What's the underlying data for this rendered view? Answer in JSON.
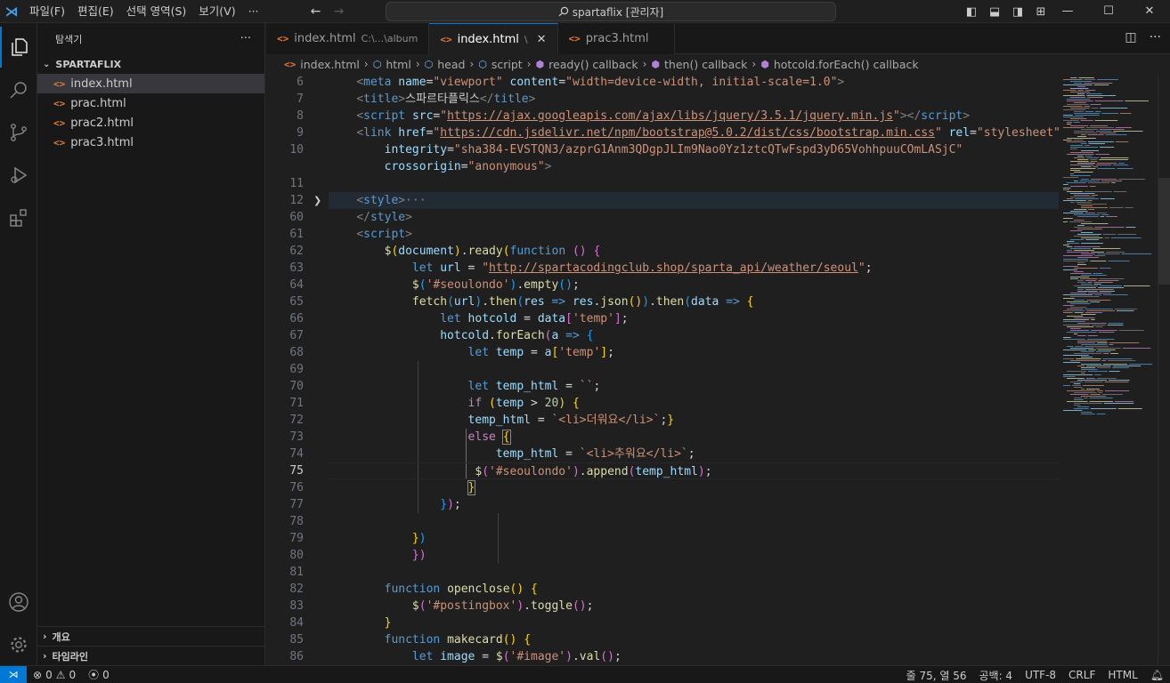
{
  "titlebar": {
    "menu": [
      "파일(F)",
      "편집(E)",
      "선택 영역(S)",
      "보기(V)",
      "···"
    ],
    "search_text": "spartaflix [관리자]",
    "minimize": "—",
    "maximize": "☐",
    "close": "✕"
  },
  "sidebar": {
    "title": "탐색기",
    "more": "···",
    "folder": "SPARTAFLIX",
    "files": [
      "index.html",
      "prac.html",
      "prac2.html",
      "prac3.html"
    ],
    "selected_file": "index.html",
    "outline_label": "개요",
    "timeline_label": "타임라인"
  },
  "tabs": [
    {
      "label": "index.html",
      "desc": "C:\\...\\album",
      "active": false
    },
    {
      "label": "index.html",
      "desc": "\\",
      "active": true
    },
    {
      "label": "prac3.html",
      "desc": "",
      "active": false
    }
  ],
  "breadcrumbs": [
    "index.html",
    "html",
    "head",
    "script",
    "ready() callback",
    "then() callback",
    "hotcold.forEach() callback"
  ],
  "editor": {
    "line_numbers": [
      "6",
      "7",
      "8",
      "9",
      "10",
      "",
      "11",
      "12",
      "60",
      "61",
      "62",
      "63",
      "64",
      "65",
      "66",
      "67",
      "68",
      "69",
      "70",
      "71",
      "72",
      "73",
      "74",
      "75",
      "76",
      "77",
      "78",
      "79",
      "80",
      "81",
      "82",
      "83",
      "84",
      "85",
      "86"
    ],
    "current_line": "75"
  },
  "statusbar": {
    "errors": "0",
    "warnings": "0",
    "ports": "0",
    "position": "줄 75, 열 56",
    "spaces": "공백: 4",
    "encoding": "UTF-8",
    "eol": "CRLF",
    "language": "HTML"
  },
  "colors": {
    "accent": "#0078d4",
    "editor_bg": "#1f1f1f",
    "sidebar_bg": "#181818"
  }
}
